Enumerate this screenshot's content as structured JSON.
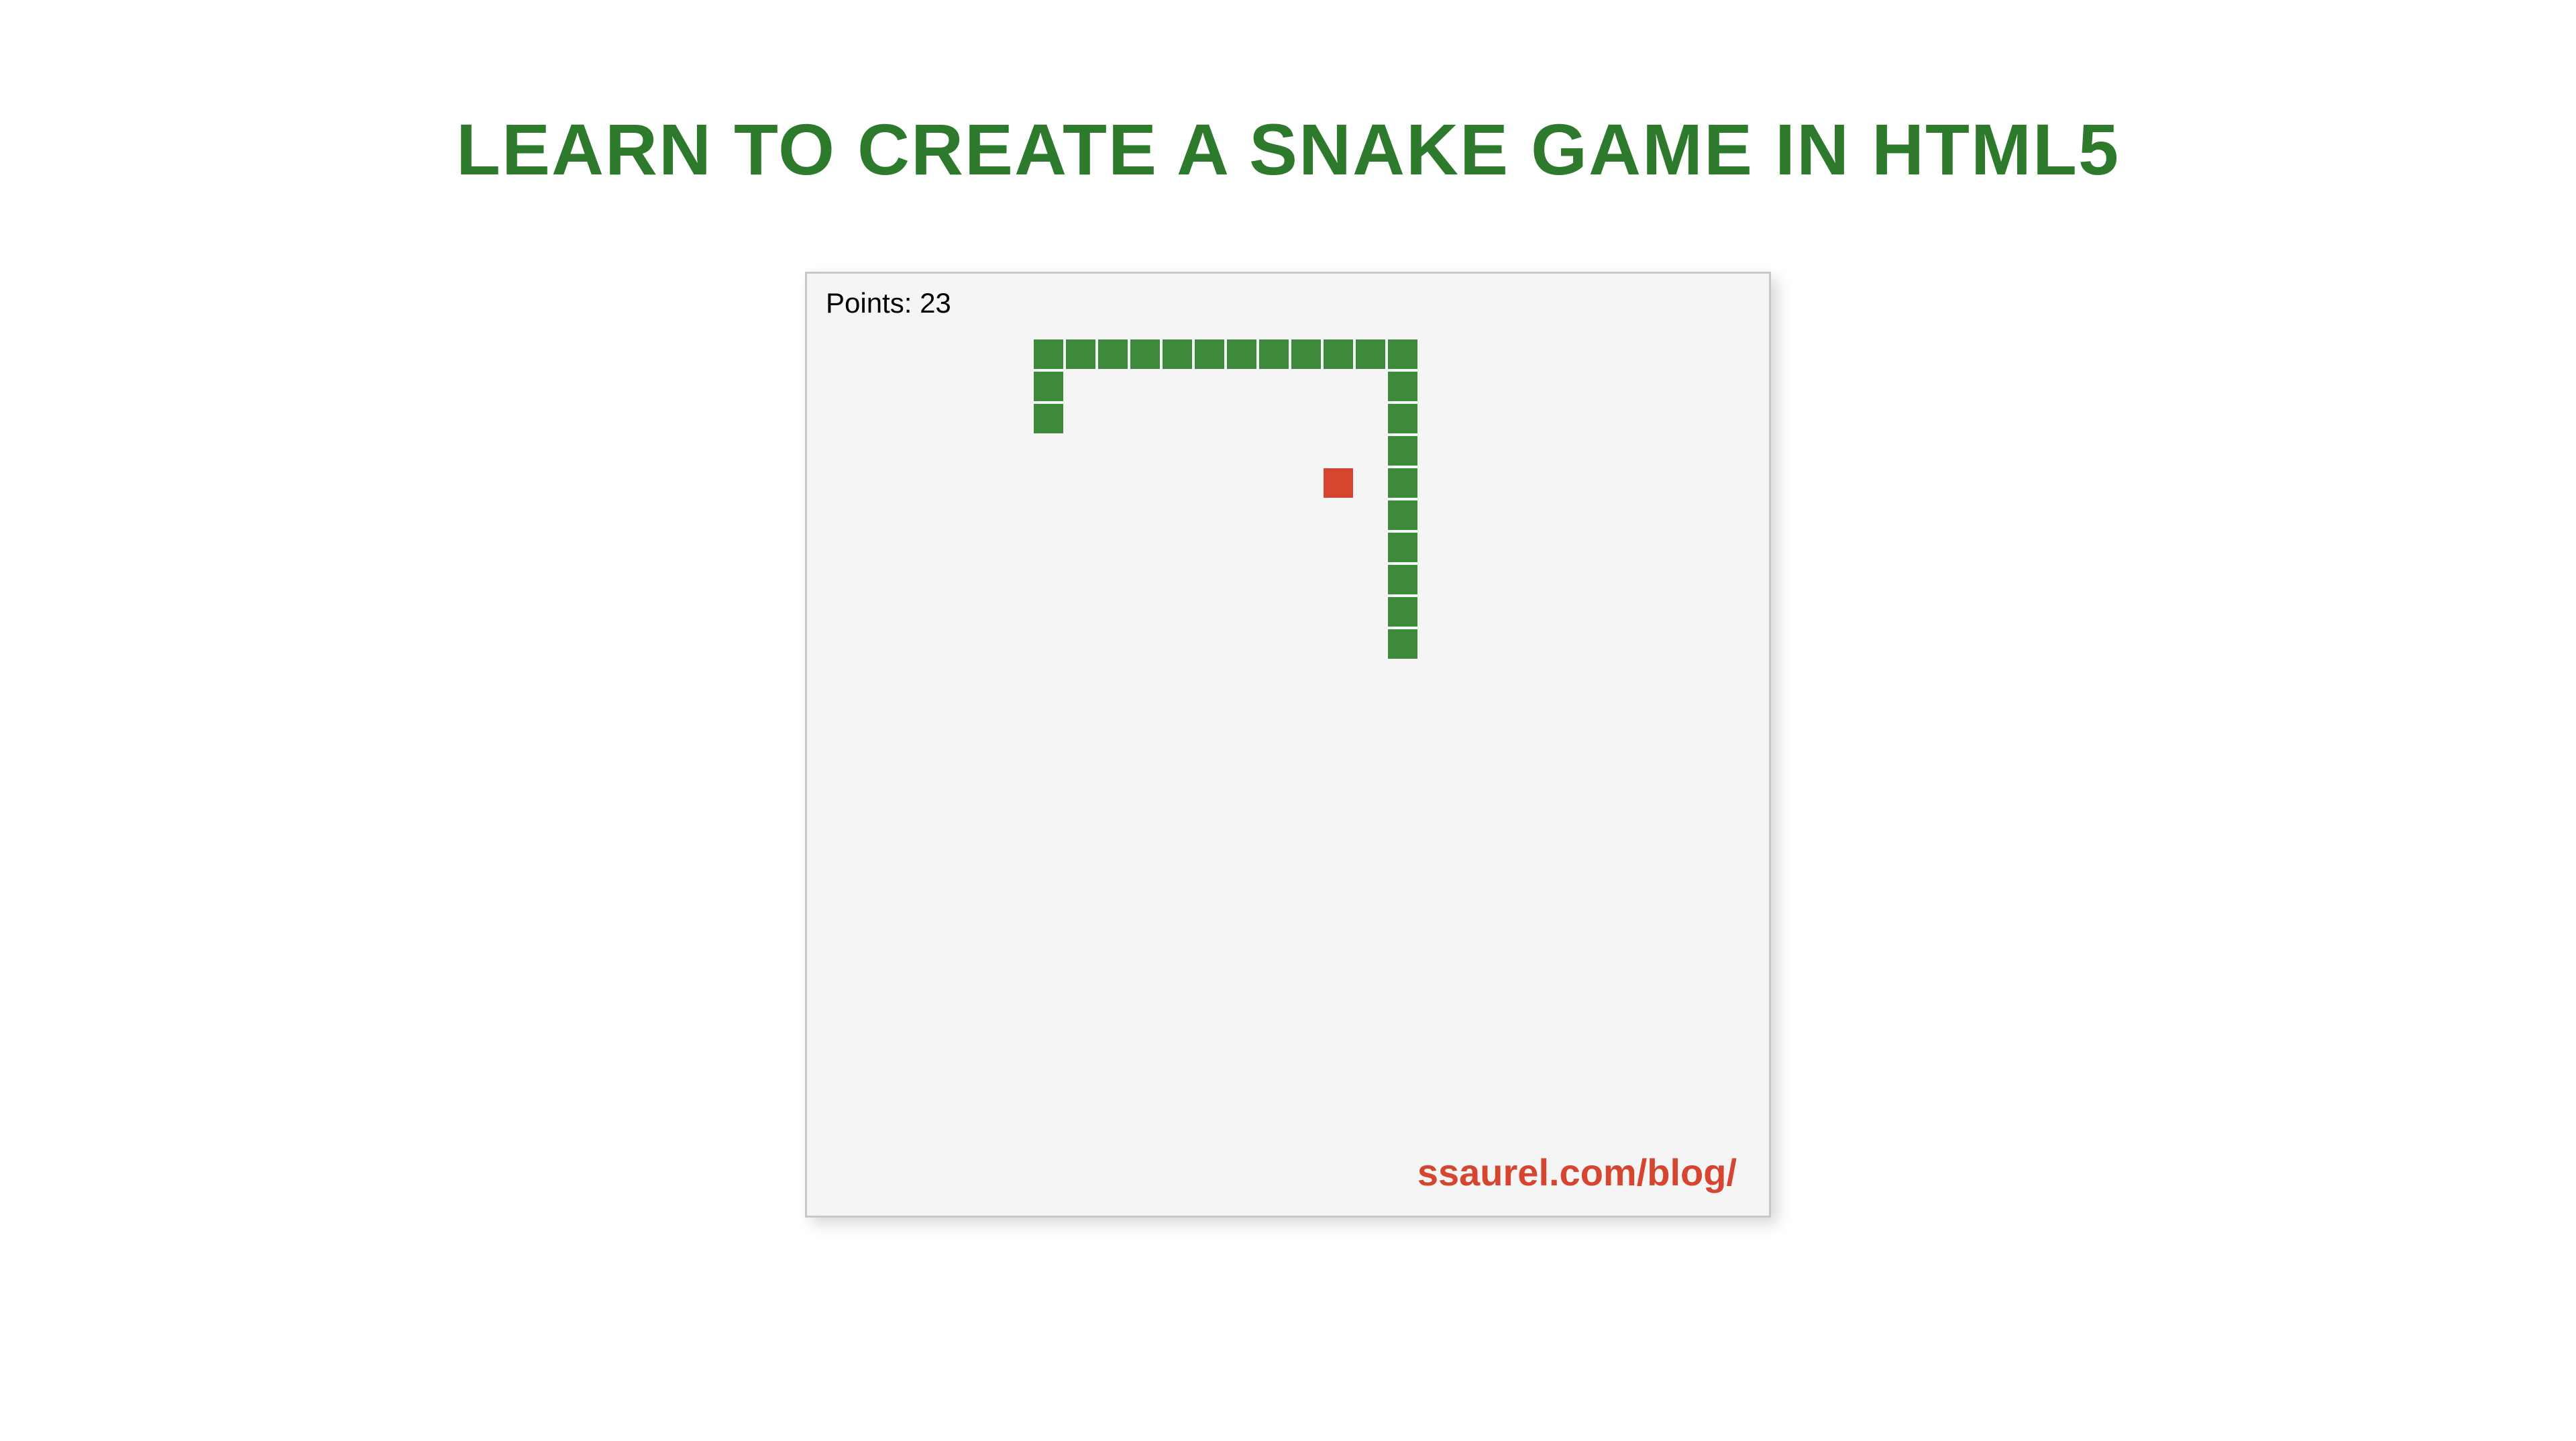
{
  "title": "LEARN TO CREATE A SNAKE GAME IN HTML5",
  "game": {
    "points_label": "Points: 23",
    "points": 23,
    "cell_size": 48,
    "offset_x": 0,
    "offset_y": 0,
    "snake_color": "#3d8a3d",
    "food_color": "#d64530",
    "snake_segments": [
      {
        "col": 7,
        "row": 4
      },
      {
        "col": 7,
        "row": 3
      },
      {
        "col": 7,
        "row": 2
      },
      {
        "col": 8,
        "row": 2
      },
      {
        "col": 9,
        "row": 2
      },
      {
        "col": 10,
        "row": 2
      },
      {
        "col": 11,
        "row": 2
      },
      {
        "col": 12,
        "row": 2
      },
      {
        "col": 13,
        "row": 2
      },
      {
        "col": 14,
        "row": 2
      },
      {
        "col": 15,
        "row": 2
      },
      {
        "col": 16,
        "row": 2
      },
      {
        "col": 17,
        "row": 2
      },
      {
        "col": 18,
        "row": 2
      },
      {
        "col": 18,
        "row": 3
      },
      {
        "col": 18,
        "row": 4
      },
      {
        "col": 18,
        "row": 5
      },
      {
        "col": 18,
        "row": 6
      },
      {
        "col": 18,
        "row": 7
      },
      {
        "col": 18,
        "row": 8
      },
      {
        "col": 18,
        "row": 9
      },
      {
        "col": 18,
        "row": 10
      },
      {
        "col": 18,
        "row": 11
      }
    ],
    "food": {
      "col": 16,
      "row": 6
    }
  },
  "blog_url": "ssaurel.com/blog/"
}
